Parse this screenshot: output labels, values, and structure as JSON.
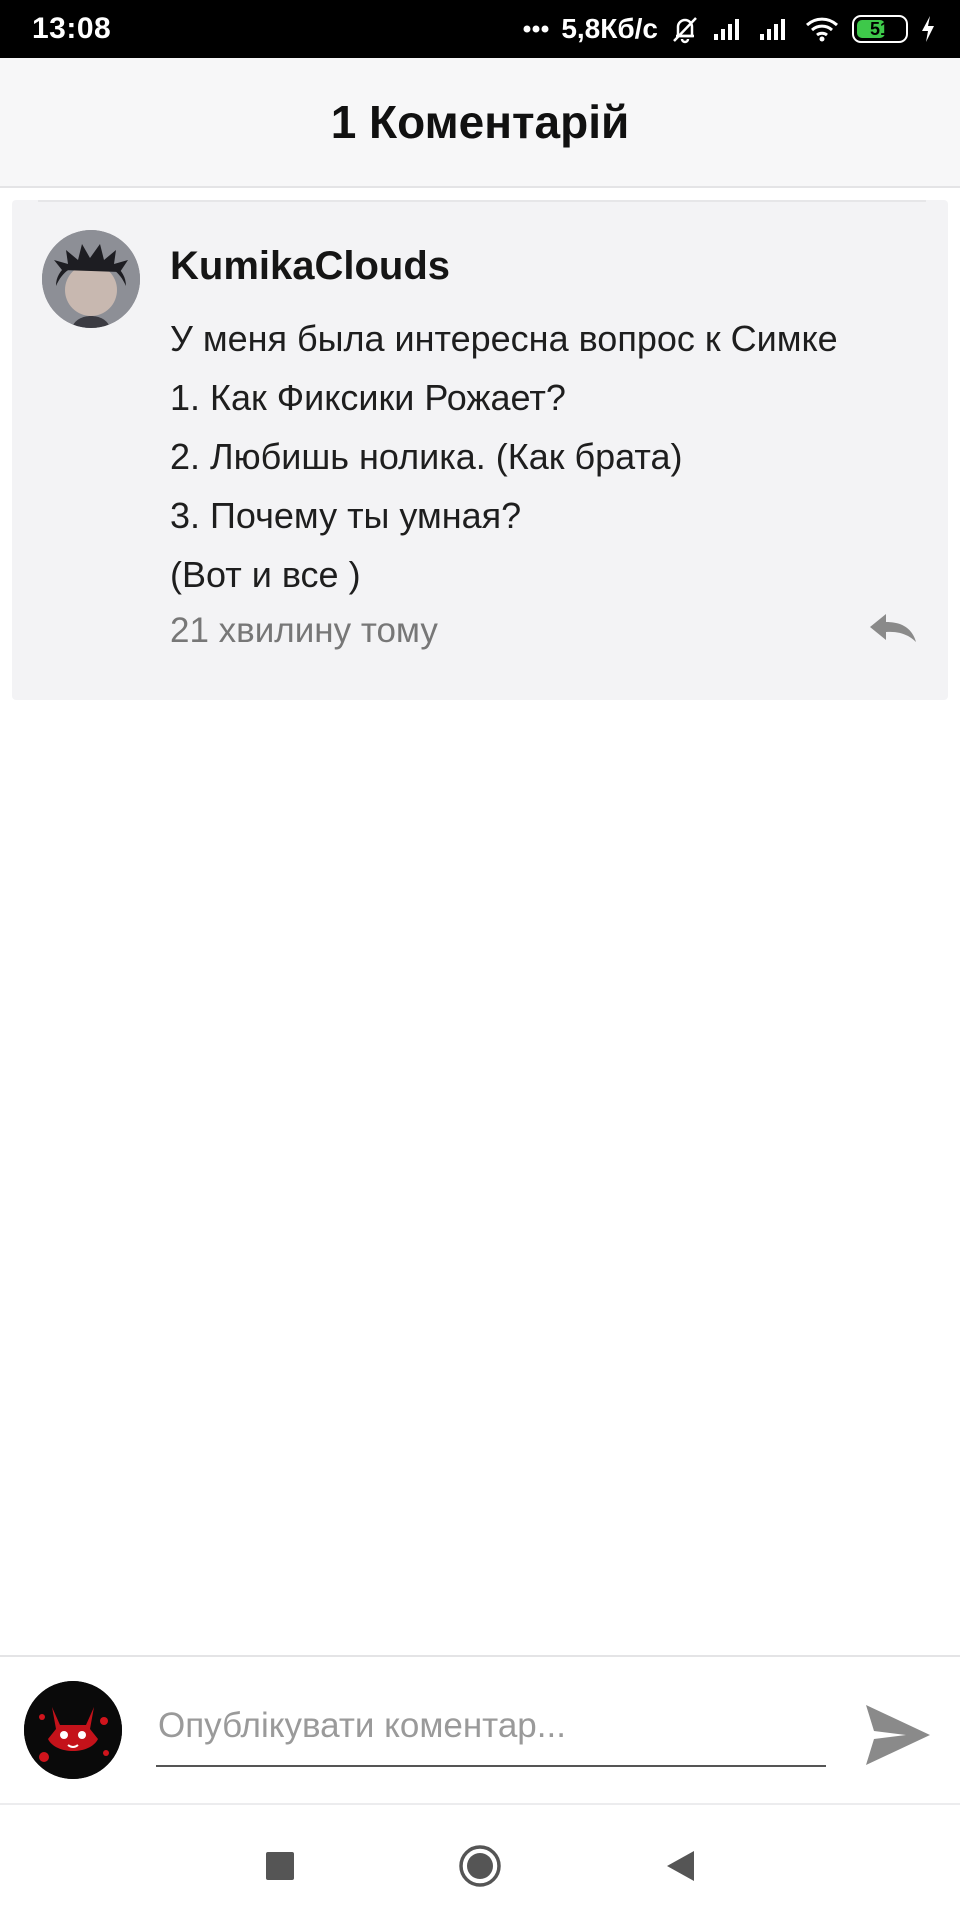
{
  "status_bar": {
    "time": "13:08",
    "network_speed": "5,8Кб/с",
    "battery_level": "51",
    "icons": [
      "dots-icon",
      "mute-bell-icon",
      "signal-icon",
      "signal-icon",
      "wifi-icon",
      "battery-icon",
      "charging-icon"
    ]
  },
  "header": {
    "title": "1 Коментарій"
  },
  "comment": {
    "author": "KumikaClouds",
    "lines": [
      "У меня была интересна вопрос к Симке",
      "1. Как Фиксики Рожает?",
      "2. Любишь нолика. (Как брата)",
      "3. Почему ты умная?",
      "(Вот и все )"
    ],
    "time": "21 хвилину тому",
    "reply_icon": "reply-icon"
  },
  "composer": {
    "placeholder": "Опублікувати коментар...",
    "value": "",
    "send_icon": "send-icon"
  },
  "nav_bar": {
    "icons": [
      "recents-icon",
      "home-icon",
      "back-icon"
    ]
  },
  "colors": {
    "header_bg": "#f7f7f8",
    "card_bg": "#f3f3f5",
    "meta_text": "#777777",
    "icon_gray": "#8a8a8a"
  }
}
